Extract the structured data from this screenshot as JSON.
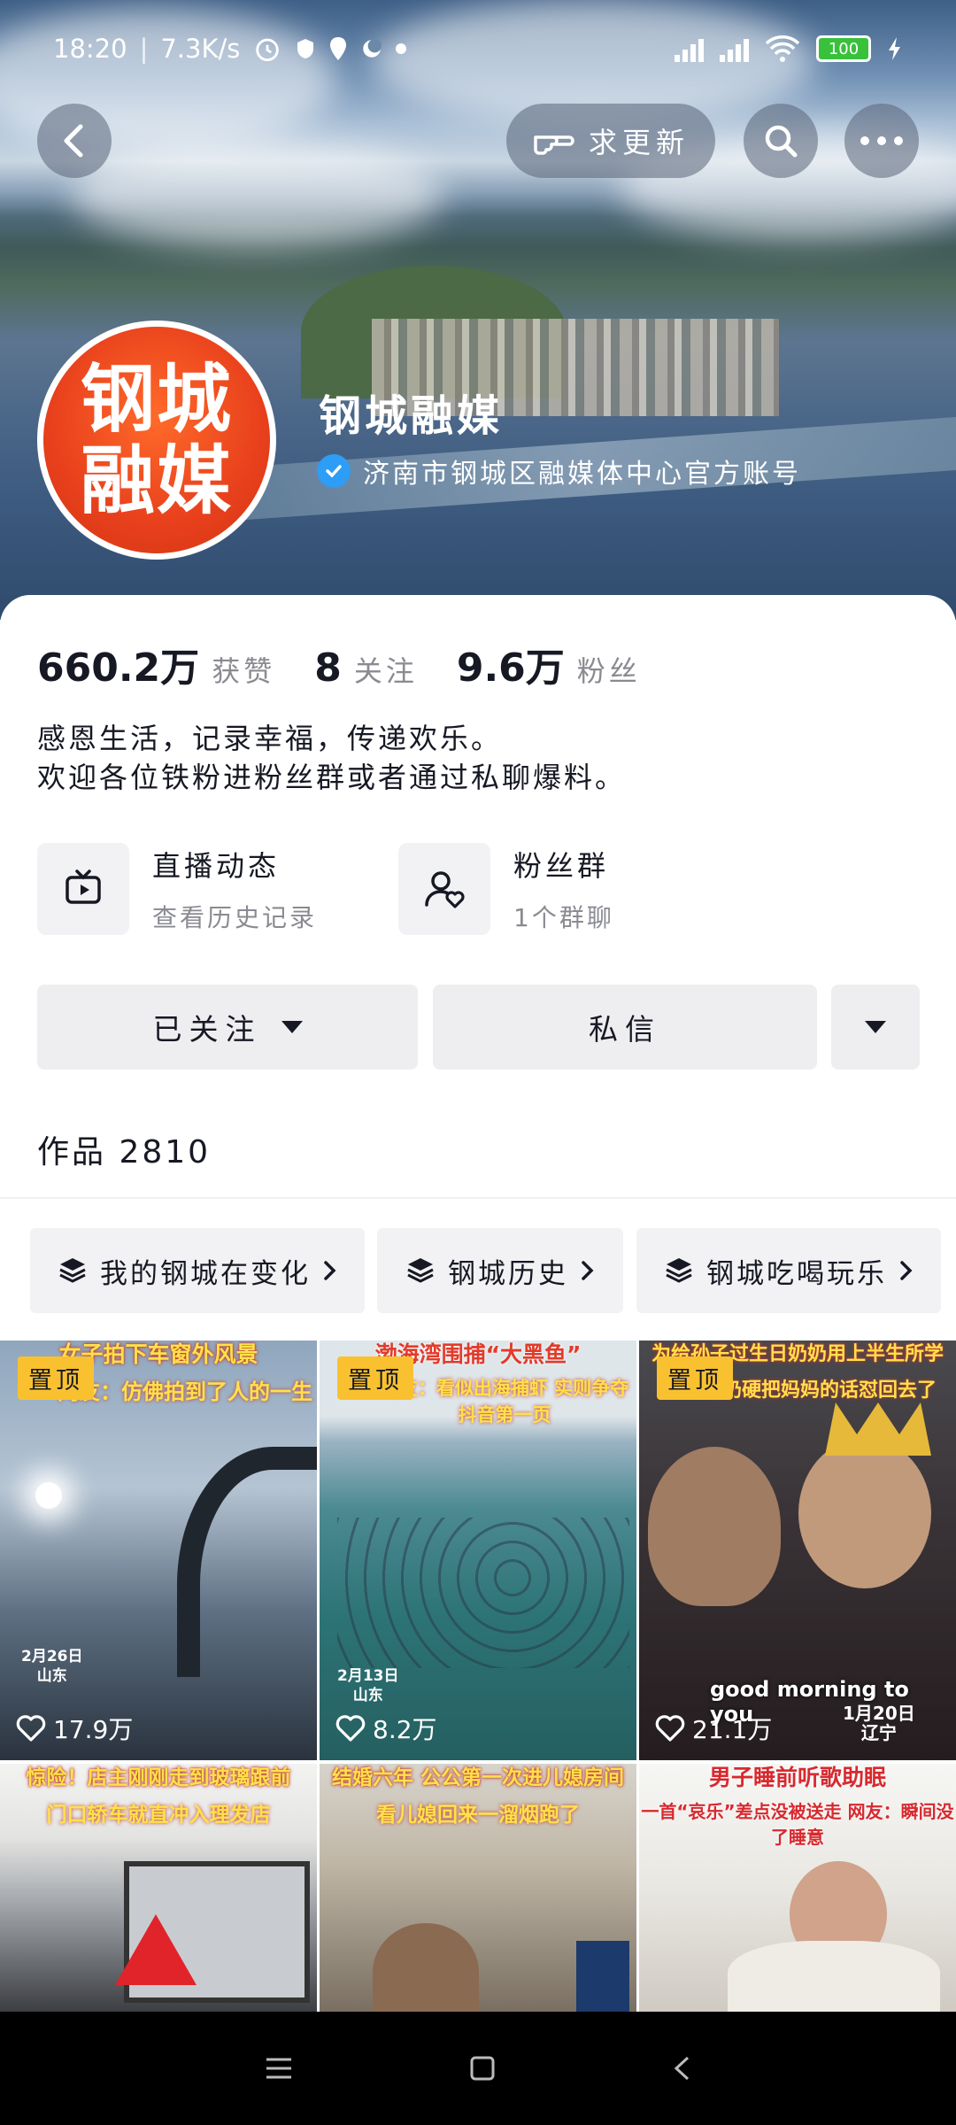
{
  "status_bar": {
    "time": "18:20",
    "speed": "7.3K/s",
    "battery": "100"
  },
  "header": {
    "request_update_label": "求更新"
  },
  "profile": {
    "name": "钢城融媒",
    "avatar_text_1": "钢城",
    "avatar_text_2": "融媒",
    "verified_text": "济南市钢城区融媒体中心官方账号"
  },
  "stats": {
    "likes_value": "660.2万",
    "likes_label": "获赞",
    "following_value": "8",
    "following_label": "关注",
    "followers_value": "9.6万",
    "followers_label": "粉丝"
  },
  "bio": {
    "line1": "感恩生活，记录幸福，传递欢乐。",
    "line2": "欢迎各位铁粉进粉丝群或者通过私聊爆料。"
  },
  "features": [
    {
      "title": "直播动态",
      "subtitle": "查看历史记录",
      "icon": "tv-icon"
    },
    {
      "title": "粉丝群",
      "subtitle": "1个群聊",
      "icon": "user-heart-icon"
    }
  ],
  "actions": {
    "followed_label": "已关注",
    "message_label": "私信"
  },
  "works": {
    "label": "作品 2810"
  },
  "collections": [
    {
      "label": "我的钢城在变化"
    },
    {
      "label": "钢城历史"
    },
    {
      "label": "钢城吃喝玩乐"
    }
  ],
  "videos": [
    {
      "caption": "女子拍下车窗外风景",
      "caption2": "网友：仿佛拍到了人的一生",
      "pinned": "置顶",
      "date": "2月26日",
      "location": "山东",
      "likes": "17.9万"
    },
    {
      "caption": "渤海湾围捕“大黑鱼”",
      "caption2": "网友：看似出海捕虾 实则争夺抖音第一页",
      "pinned": "置顶",
      "date": "2月13日",
      "location": "山东",
      "likes": "8.2万"
    },
    {
      "caption": "为给孙子过生日奶奶用上半生所学",
      "caption2": "奶奶硬把妈妈的话怼回去了",
      "pinned": "置顶",
      "date": "1月20日",
      "location": "辽宁",
      "likes": "21.1万",
      "overlay": "good morning to you"
    },
    {
      "caption": "惊险！店主刚刚走到玻璃跟前",
      "caption2": "门口轿车就直冲入理发店"
    },
    {
      "caption": "结婚六年 公公第一次进儿媳房间",
      "caption2": "看儿媳回来一溜烟跑了"
    },
    {
      "caption": "男子睡前听歌助眠",
      "caption2": "一首“哀乐”差点没被送走 网友：瞬间没了睡意"
    }
  ]
}
